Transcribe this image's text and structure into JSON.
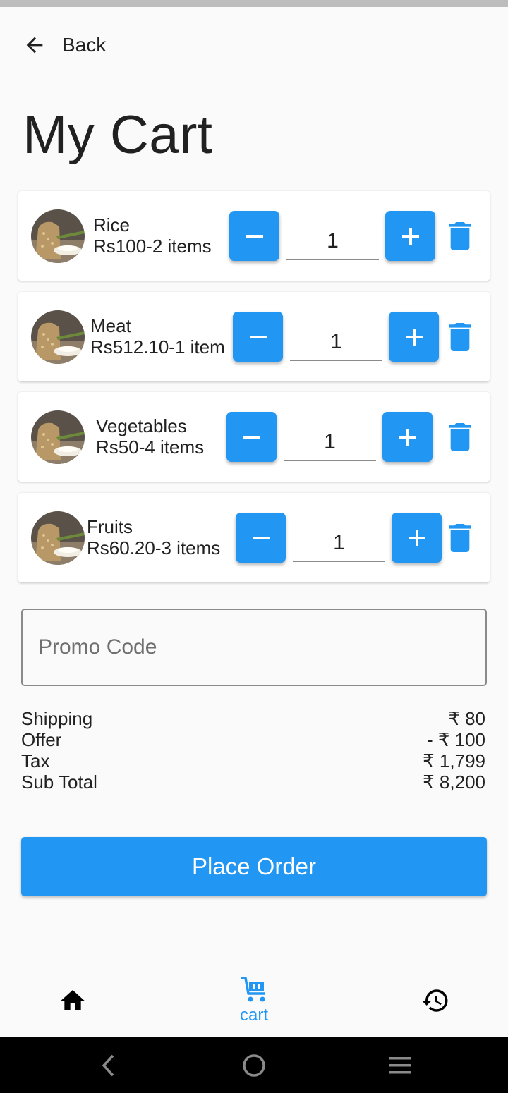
{
  "header": {
    "back_label": "Back",
    "title": "My Cart"
  },
  "cart_items": [
    {
      "name": "Rice",
      "detail": "Rs100-2 items",
      "quantity": "1"
    },
    {
      "name": "Meat",
      "detail": "Rs512.10-1 item",
      "quantity": "1"
    },
    {
      "name": "Vegetables",
      "detail": "Rs50-4 items",
      "quantity": "1"
    },
    {
      "name": "Fruits",
      "detail": "Rs60.20-3 items",
      "quantity": "1"
    }
  ],
  "promo": {
    "placeholder": "Promo Code",
    "value": ""
  },
  "summary": [
    {
      "label": "Shipping",
      "value": "₹ 80"
    },
    {
      "label": "Offer",
      "value": "- ₹ 100"
    },
    {
      "label": "Tax",
      "value": "₹ 1,799"
    },
    {
      "label": "Sub Total",
      "value": "₹ 8,200"
    }
  ],
  "place_order_label": "Place Order",
  "bottom_nav": {
    "cart_label": "cart",
    "active": "cart"
  },
  "icons": {
    "back": "arrow-left-icon",
    "minus": "minus-icon",
    "plus": "plus-icon",
    "delete": "trash-icon",
    "home": "home-icon",
    "cart": "shopping-cart-icon",
    "history": "history-icon"
  },
  "colors": {
    "accent": "#2196f3",
    "background": "#fafafa",
    "text": "#212121"
  }
}
